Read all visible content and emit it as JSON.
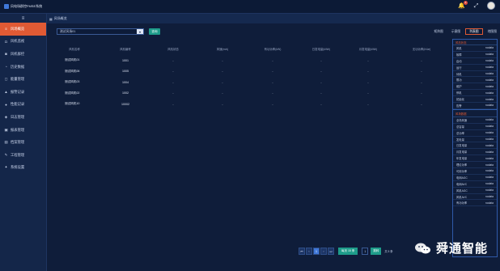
{
  "app": {
    "title": "风电场群控FMSE系统"
  },
  "topbar": {
    "notification_count": "3"
  },
  "sidebar": {
    "items": [
      {
        "label": "风场概览",
        "icon": "≡",
        "active": true
      },
      {
        "label": "风机监视",
        "icon": "◘"
      },
      {
        "label": "风机群控",
        "icon": "◙"
      },
      {
        "label": "历史数据",
        "icon": "◔"
      },
      {
        "label": "能量管理",
        "icon": "◻"
      },
      {
        "label": "报警记录",
        "icon": "▲"
      },
      {
        "label": "性能记录",
        "icon": "●"
      },
      {
        "label": "日志管理",
        "icon": "◈"
      },
      {
        "label": "报表管理",
        "icon": "▣"
      },
      {
        "label": "档案管理",
        "icon": "▤"
      },
      {
        "label": "工程管理",
        "icon": "✎"
      },
      {
        "label": "系统设置",
        "icon": "✦"
      }
    ]
  },
  "breadcrumb": {
    "label": "风场概览"
  },
  "toolbar": {
    "select_value": "测试风场01",
    "query_label": "查询",
    "tabs": [
      {
        "label": "矩阵图"
      },
      {
        "label": "示意图"
      },
      {
        "label": "列表图",
        "active": true
      },
      {
        "label": "地图图"
      }
    ]
  },
  "table": {
    "headers": [
      "风机名称",
      "风机编号",
      "风机状态",
      "风速(m/s)",
      "有功功率(kW)",
      "日发电量(kWh)",
      "月发电量(kWh)",
      "无功功率(kVar)"
    ],
    "rows": [
      [
        "测试风机01",
        "1001",
        "-",
        "-",
        "-",
        "-",
        "-",
        "-"
      ],
      [
        "测试风机06",
        "1005",
        "-",
        "-",
        "-",
        "-",
        "-",
        "-"
      ],
      [
        "测试风机03",
        "1004",
        "-",
        "-",
        "-",
        "-",
        "-",
        "-"
      ],
      [
        "测试风机02",
        "1002",
        "-",
        "-",
        "-",
        "-",
        "-",
        "-"
      ],
      [
        "测试风机10",
        "10002",
        "-",
        "-",
        "-",
        "-",
        "-",
        "-"
      ]
    ]
  },
  "right_panel": {
    "section1_title": "风机状态",
    "section1": [
      {
        "label": "风机",
        "value": "nodata"
      },
      {
        "label": "故障",
        "value": "nodata"
      },
      {
        "label": "启动",
        "value": "nodata"
      },
      {
        "label": "运行",
        "value": "nodata"
      },
      {
        "label": "待机",
        "value": "nodata"
      },
      {
        "label": "限功",
        "value": "nodata"
      },
      {
        "label": "维护",
        "value": "nodata"
      },
      {
        "label": "停机",
        "value": "nodata"
      },
      {
        "label": "初始化",
        "value": "nodata"
      },
      {
        "label": "告警",
        "value": "nodata"
      }
    ],
    "section2_title": "风场数据",
    "section2": [
      {
        "label": "全场风速",
        "value": "nodata"
      },
      {
        "label": "总容量",
        "value": "nodata"
      },
      {
        "label": "总功率",
        "value": "nodata"
      },
      {
        "label": "发电量",
        "value": "nodata"
      },
      {
        "label": "日发电量",
        "value": "nodata"
      },
      {
        "label": "月发电量",
        "value": "nodata"
      },
      {
        "label": "年发电量",
        "value": "nodata"
      },
      {
        "label": "理论功率",
        "value": "nodata"
      },
      {
        "label": "可用功率",
        "value": "nodata"
      },
      {
        "label": "电网AGC",
        "value": "nodata"
      },
      {
        "label": "电网AVC",
        "value": "nodata"
      },
      {
        "label": "风机AGC",
        "value": "nodata"
      },
      {
        "label": "风机AVC",
        "value": "nodata"
      },
      {
        "label": "有功功率",
        "value": "nodata"
      }
    ]
  },
  "pager": {
    "first": "⏮",
    "prev": "‹",
    "current": "1",
    "next": "›",
    "last": "⏭",
    "size_label": "每页 15 条",
    "jump_value": "1",
    "go_label": "跳转",
    "total": "共 5 条"
  },
  "watermark": {
    "text": "舜通智能"
  }
}
